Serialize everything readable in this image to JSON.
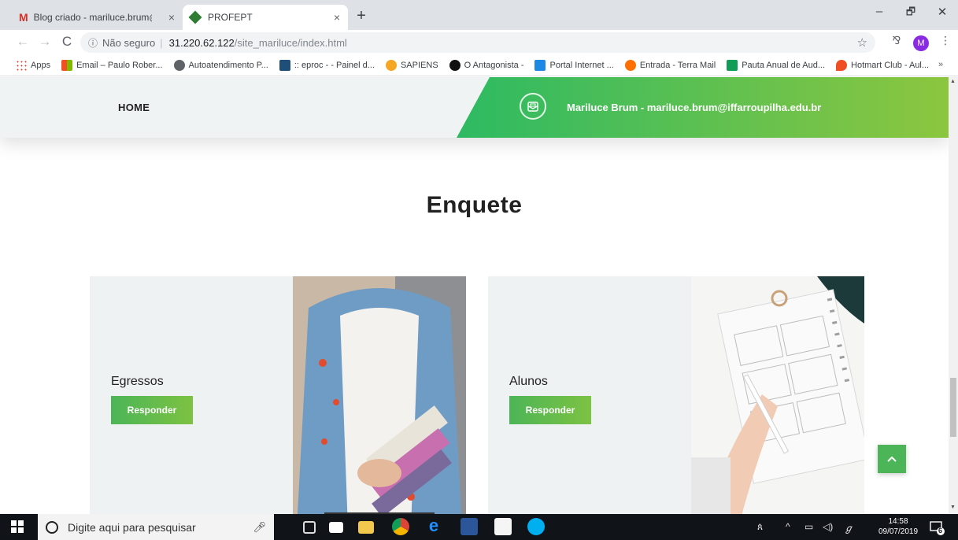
{
  "browser": {
    "tabs": [
      {
        "title": "Blog criado - mariluce.brum@iffa",
        "close": "×"
      },
      {
        "title": "PROFEPT",
        "close": "×"
      }
    ],
    "new_tab": "+",
    "window_controls": {
      "minimize": "–",
      "maximize": "🗗",
      "close": "✕"
    },
    "address": {
      "security": "Não seguro",
      "host": "31.220.62.122",
      "path": "/site_mariluce/index.html"
    },
    "avatar_letter": "M",
    "bookmarks": [
      {
        "label": "Apps",
        "icon": "apps-grid-icon"
      },
      {
        "label": "Email – Paulo Rober...",
        "icon": "microsoft-icon"
      },
      {
        "label": "Autoatendimento P...",
        "icon": "globe-icon"
      },
      {
        "label": ":: eproc - - Painel d...",
        "icon": "eproc-icon"
      },
      {
        "label": "SAPIENS",
        "icon": "sapiens-icon"
      },
      {
        "label": "O Antagonista -",
        "icon": "antagonista-icon"
      },
      {
        "label": "Portal Internet ...",
        "icon": "portal-icon"
      },
      {
        "label": "Entrada - Terra Mail",
        "icon": "terra-icon"
      },
      {
        "label": "Pauta Anual de Aud...",
        "icon": "sheets-icon"
      },
      {
        "label": "Hotmart Club - Aul...",
        "icon": "hotmart-icon"
      }
    ],
    "bookmarks_more": "»"
  },
  "page": {
    "nav": {
      "home": "HOME"
    },
    "contact": "Mariluce Brum - mariluce.brum@iffarroupilha.edu.br",
    "section_title": "Enquete",
    "cards": [
      {
        "label": "Egressos",
        "button": "Responder"
      },
      {
        "label": "Alunos",
        "button": "Responder"
      }
    ]
  },
  "taskbar": {
    "search_placeholder": "Digite aqui para pesquisar",
    "time": "14:58",
    "date": "09/07/2019",
    "notification_count": "6"
  },
  "colors": {
    "accent_green": "#4cb557",
    "header_bg": "#f0f3f4",
    "card_bg": "#eef2f3"
  }
}
